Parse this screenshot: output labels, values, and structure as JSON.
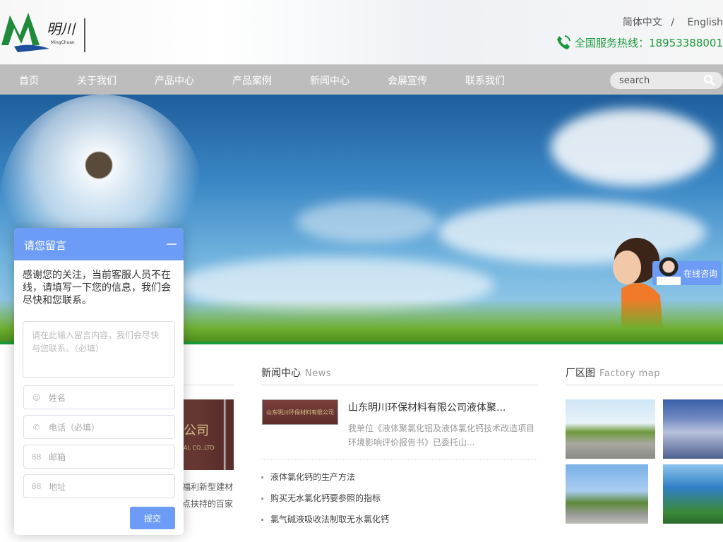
{
  "header": {
    "logo_text": "明川",
    "logo_sub": "MingChuan",
    "lang_cn": "简体中文",
    "lang_sep": "/",
    "lang_en": "English",
    "hotline": "全国服务热线：18953388001"
  },
  "nav": {
    "items": [
      "首页",
      "关于我们",
      "产品中心",
      "产品案例",
      "新闻中心",
      "会展宣传",
      "联系我们"
    ],
    "search_placeholder": "search"
  },
  "colors": {
    "accent": "#6c9cf5",
    "brand_green": "#1a9a3c",
    "nav_bg": "#bdbdbd"
  },
  "consult": {
    "label": "在线咨询"
  },
  "left": {
    "img_text": "公司",
    "img_sub": "AL CO.,LTD",
    "lines": [
      "福利新型建材",
      "点扶持的百家"
    ]
  },
  "news": {
    "title": "新闻中心",
    "title_en": "News",
    "featured": {
      "img_text": "山东明川环保材料有限公司",
      "title": "山东明川环保材料有限公司液体聚...",
      "desc": "我单位《液体聚氯化铝及液体氯化钙技术改造项目环境影响评价报告书》已委托山..."
    },
    "items": [
      "液体氯化钙的生产方法",
      "购买无水氯化钙要参照的指标",
      "氯气碱液吸收法制取无水氯化钙"
    ]
  },
  "factory": {
    "title": "厂区图",
    "title_en": "Factory map"
  },
  "chat": {
    "title": "请您留言",
    "intro": "感谢您的关注，当前客服人员不在线，请填写一下您的信息，我们会尽快和您联系。",
    "message_placeholder": "请在此输入留言内容，我们会尽快与您联系。（必填）",
    "name_placeholder": "姓名",
    "phone_placeholder": "电话（必填）",
    "email_placeholder": "邮箱",
    "address_placeholder": "地址",
    "submit": "提交"
  }
}
